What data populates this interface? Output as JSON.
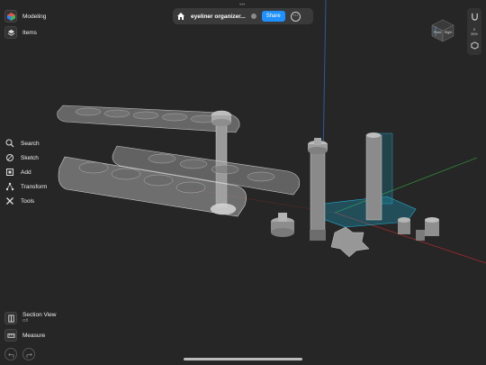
{
  "top_left": {
    "items": [
      {
        "label": "Modeling",
        "icon": "cube-color-icon"
      },
      {
        "label": "Items",
        "icon": "layers-icon"
      }
    ]
  },
  "top_bar": {
    "document_title": "eyeliner organizer...",
    "share_label": "Share",
    "dot_color": "#ff5a3c"
  },
  "left_tools": {
    "items": [
      {
        "label": "Search",
        "icon": "search-icon"
      },
      {
        "label": "Sketch",
        "icon": "sketch-icon"
      },
      {
        "label": "Add",
        "icon": "add-icon"
      },
      {
        "label": "Transform",
        "icon": "transform-icon"
      },
      {
        "label": "Tools",
        "icon": "tools-icon"
      }
    ]
  },
  "bottom_left": {
    "section_view": {
      "label": "Section View",
      "state": "Off"
    },
    "measure_label": "Measure"
  },
  "view_cube": {
    "front": "Front",
    "right": "Right"
  },
  "right_bar": {
    "items": [
      {
        "label": "",
        "icon": "snap-icon"
      },
      {
        "label": "0\n35%",
        "icon": "zoom-readout"
      },
      {
        "label": "",
        "icon": "display-mode-icon"
      }
    ]
  },
  "colors": {
    "background": "#262626",
    "accent": "#1e90ff",
    "cyan_sketch": "#1aa7c8",
    "part_gray": "#7a7a7a"
  }
}
